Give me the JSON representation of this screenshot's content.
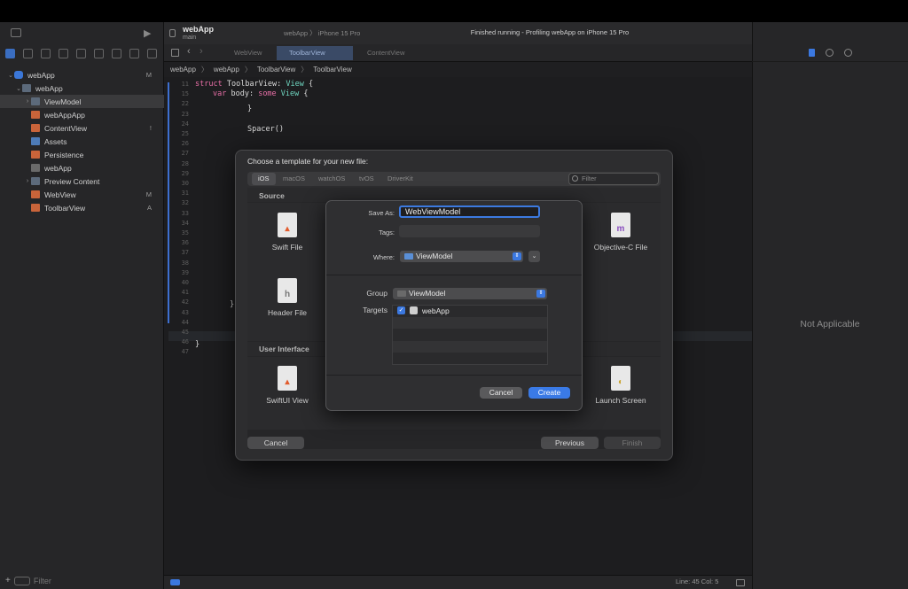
{
  "window": {
    "project_name": "webApp",
    "branch": "main",
    "scheme": "webApp 〉 iPhone 15 Pro",
    "status": "Finished running - Profiling webApp on iPhone 15 Pro"
  },
  "editor_tabs": [
    "WebView",
    "ToolbarView",
    "ContentView"
  ],
  "breadcrumbs": [
    "webApp",
    "webApp",
    "ToolbarView",
    "ToolbarView"
  ],
  "navigator": {
    "items": [
      {
        "label": "webApp",
        "badge": "M"
      },
      {
        "label": "webApp",
        "badge": ""
      },
      {
        "label": "ViewModel",
        "badge": ""
      },
      {
        "label": "webAppApp",
        "badge": ""
      },
      {
        "label": "ContentView",
        "badge": "!"
      },
      {
        "label": "Assets",
        "badge": ""
      },
      {
        "label": "Persistence",
        "badge": ""
      },
      {
        "label": "webApp",
        "badge": ""
      },
      {
        "label": "Preview Content",
        "badge": ""
      },
      {
        "label": "WebView",
        "badge": "M"
      },
      {
        "label": "ToolbarView",
        "badge": "A"
      }
    ],
    "filter_placeholder": "Filter"
  },
  "code": {
    "line_numbers": [
      "11",
      "15",
      "22",
      "23",
      "24",
      "25",
      "26",
      "27",
      "28",
      "29",
      "30",
      "31",
      "32",
      "33",
      "34",
      "35",
      "36",
      "37",
      "38",
      "39",
      "40",
      "41",
      "42",
      "43",
      "44",
      "45",
      "46",
      "47"
    ],
    "line1": {
      "kw1": "struct",
      "name": "ToolbarView:",
      "type": "View",
      "rest": " {"
    },
    "line2": {
      "kw1": "var",
      "name": " body:",
      "kw2": " some",
      "type": " View",
      "rest": " {"
    },
    "spacer": "Spacer()",
    "brace1": "}",
    "brace2": "}",
    "brace3": "}"
  },
  "template_sheet": {
    "title": "Choose a template for your new file:",
    "platform_tabs": [
      "iOS",
      "macOS",
      "watchOS",
      "tvOS",
      "DriverKit"
    ],
    "filter_placeholder": "Filter",
    "section_source": "Source",
    "section_ui": "User Interface",
    "templates": {
      "swift_file": "Swift File",
      "objc_file": "Objective-C File",
      "header_file": "Header File",
      "swiftui_view": "SwiftUI View",
      "launch_screen": "Launch Screen"
    },
    "cancel": "Cancel",
    "previous": "Previous",
    "finish": "Finish"
  },
  "save_dialog": {
    "save_as_label": "Save As:",
    "save_as_value": "WebViewModel",
    "tags_label": "Tags:",
    "where_label": "Where:",
    "where_value": "ViewModel",
    "group_label": "Group",
    "group_value": "ViewModel",
    "targets_label": "Targets",
    "target_name": "webApp",
    "target_checked": true,
    "cancel": "Cancel",
    "create": "Create"
  },
  "inspector": {
    "empty_text": "Not Applicable"
  },
  "status_bar": {
    "position": "Line: 45  Col: 5"
  },
  "colors": {
    "accent": "#3a7ae6",
    "keyword": "#e86fa7",
    "type": "#6fd6c0"
  }
}
